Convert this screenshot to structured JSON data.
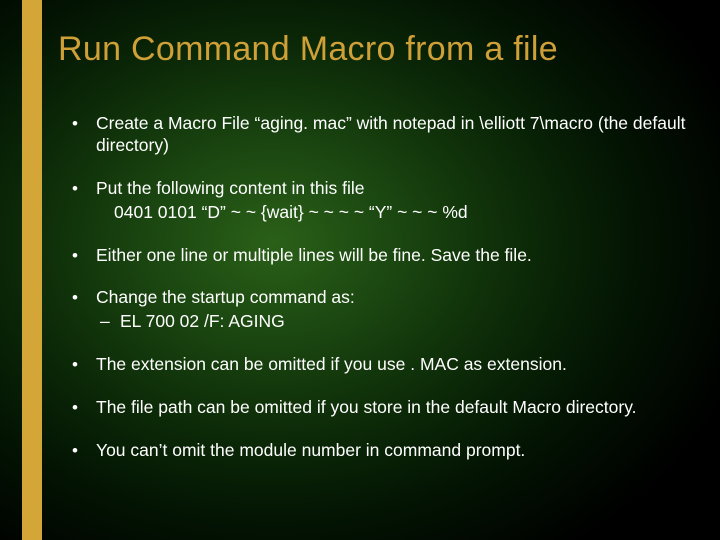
{
  "title": "Run Command Macro from a file",
  "bullets": [
    {
      "text": "Create a Macro File “aging. mac” with notepad in \\elliott 7\\macro (the default directory)"
    },
    {
      "text": "Put the following content in this file",
      "sub": "0401 0101 “D” ~ ~ {wait} ~ ~ ~ ~ “Y” ~ ~ ~ %d"
    },
    {
      "text": "Either one line or multiple lines will be fine.  Save the file."
    },
    {
      "text": "Change the startup command as:",
      "subdash": "EL 700 02 /F: AGING"
    },
    {
      "text": "The extension can be omitted if you use . MAC as extension."
    },
    {
      "text": "The file path can be omitted if you store in the default Macro directory."
    },
    {
      "text": "You can’t omit the module number in command prompt."
    }
  ]
}
